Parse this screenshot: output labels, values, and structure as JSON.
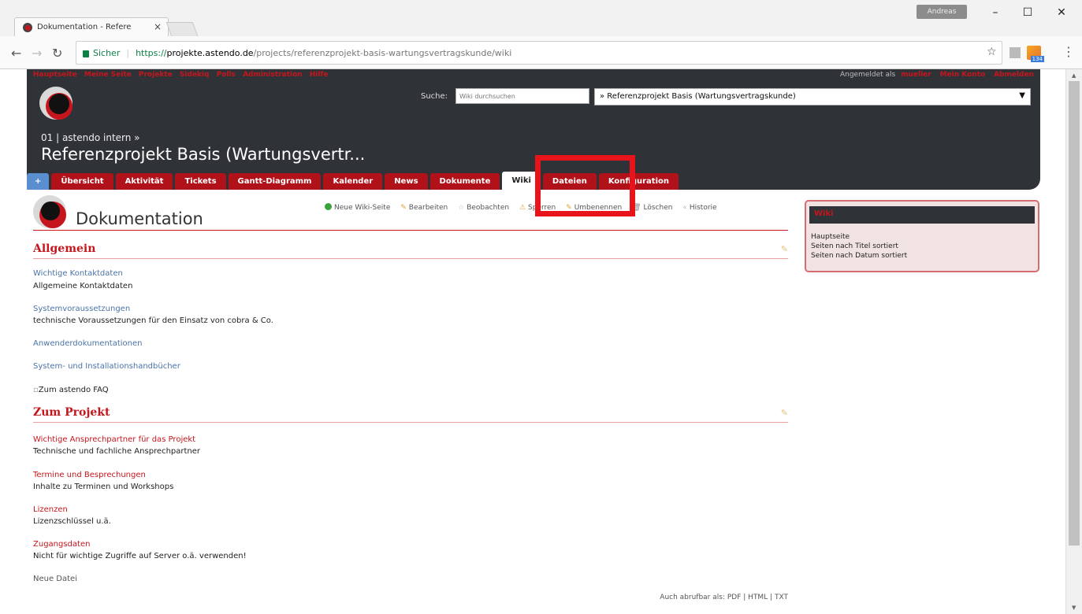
{
  "browser": {
    "tab_title": "Dokumentation - Refere",
    "user_badge": "Andreas",
    "secure_label": "Sicher",
    "url_proto": "https://",
    "url_host": "projekte.astendo.de",
    "url_path": "/projects/referenzprojekt-basis-wartungsvertragskunde/wiki",
    "ext_badge": "134"
  },
  "topmenu": [
    "Hauptseite",
    "Meine Seite",
    "Projekte",
    "Sidekiq",
    "Polls",
    "Administration",
    "Hilfe"
  ],
  "account": {
    "logged_in_as": "Angemeldet als",
    "username": "mueller",
    "my_account": "Mein Konto",
    "logout": "Abmelden"
  },
  "search": {
    "label": "Suche:",
    "placeholder": "Wiki durchsuchen"
  },
  "project_select": "» Referenzprojekt Basis (Wartungsvertragskunde)",
  "breadcrumb": "01 | astendo intern »",
  "project_title": "Referenzprojekt Basis (Wartungsvertr...",
  "tabs": {
    "plus": "+",
    "overview": "Übersicht",
    "activity": "Aktivität",
    "tickets": "Tickets",
    "gantt": "Gantt-Diagramm",
    "calendar": "Kalender",
    "news": "News",
    "documents": "Dokumente",
    "wiki": "Wiki",
    "files": "Dateien",
    "config": "Konfiguration"
  },
  "page": {
    "title": "Dokumentation",
    "actions": {
      "new": "Neue Wiki-Seite",
      "edit": "Bearbeiten",
      "watch": "Beobachten",
      "lock": "Sperren",
      "rename": "Umbenennen",
      "delete": "Löschen",
      "history": "Historie"
    },
    "section1": "Allgemein",
    "section2": "Zum Projekt",
    "items": {
      "contacts_link": "Wichtige Kontaktdaten",
      "contacts_desc": "Allgemeine Kontaktdaten",
      "sysreq_link": "Systemvoraussetzungen",
      "sysreq_desc": "technische Voraussetzungen für den Einsatz von cobra & Co.",
      "userdocs_link": "Anwenderdokumentationen",
      "install_link": "System- und Installationshandbücher",
      "faq_link": "Zum astendo FAQ",
      "partner_link": "Wichtige Ansprechpartner für das Projekt",
      "partner_desc": "Technische und fachliche Ansprechpartner",
      "meetings_link": "Termine und Besprechungen",
      "meetings_desc": "Inhalte zu Terminen und Workshops",
      "licenses_link": "Lizenzen",
      "licenses_desc": "Lizenzschlüssel u.ä.",
      "access_link": "Zugangsdaten",
      "access_desc": "Nicht für wichtige Zugriffe auf Server o.ä. verwenden!",
      "newfile_link": "Neue Datei"
    },
    "footer": {
      "prefix": "Auch abrufbar als:",
      "pdf": "PDF",
      "html": "HTML",
      "txt": "TXT"
    }
  },
  "sidebar": {
    "title": "Wiki",
    "links": [
      "Hauptseite",
      "Seiten nach Titel sortiert",
      "Seiten nach Datum sortiert"
    ]
  },
  "colors": {
    "brand_red": "#c4161c",
    "header_dark": "#2f3338",
    "highlight": "#e8141c"
  }
}
